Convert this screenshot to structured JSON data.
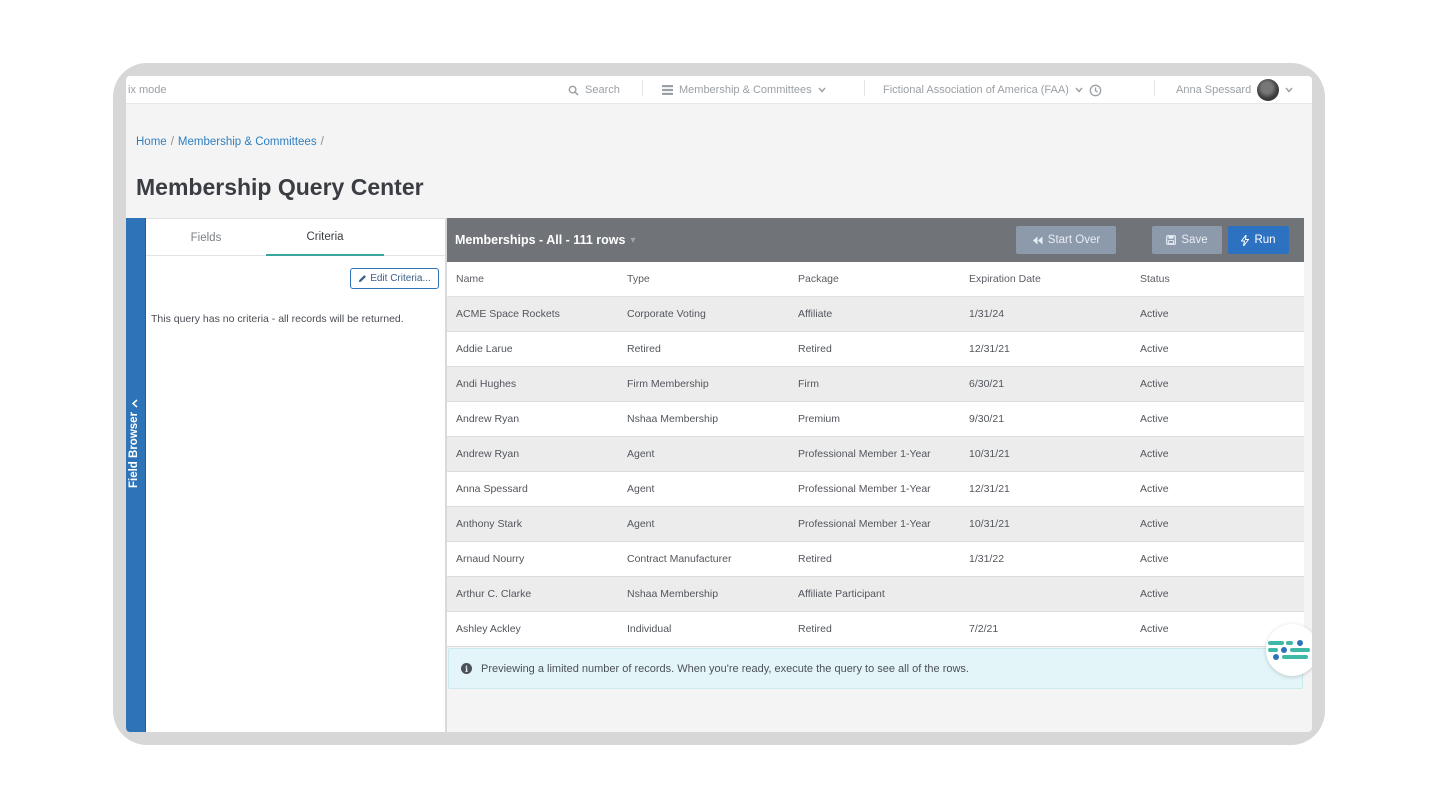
{
  "topbar": {
    "mode_label": "ix mode",
    "search_placeholder": "Search",
    "module_label": "Membership & Committees",
    "org_label": "Fictional Association of America (FAA)",
    "user_name": "Anna Spessard"
  },
  "breadcrumb": {
    "home": "Home",
    "section": "Membership & Committees"
  },
  "page_title": "Membership Query Center",
  "field_browser_label": "Field Browser",
  "left_panel": {
    "tabs": [
      {
        "label": "Fields",
        "active": false
      },
      {
        "label": "Criteria",
        "active": true
      }
    ],
    "edit_criteria_label": "Edit Criteria...",
    "no_criteria_text": "This query has no criteria - all records will be returned."
  },
  "results": {
    "title": "Memberships - All - 111 rows",
    "start_over_label": "Start Over",
    "save_label": "Save",
    "run_label": "Run",
    "columns": [
      "Name",
      "Type",
      "Package",
      "Expiration Date",
      "Status"
    ],
    "rows": [
      [
        "ACME Space Rockets",
        "Corporate Voting",
        "Affiliate",
        "1/31/24",
        "Active"
      ],
      [
        "Addie Larue",
        "Retired",
        "Retired",
        "12/31/21",
        "Active"
      ],
      [
        "Andi Hughes",
        "Firm Membership",
        "Firm",
        "6/30/21",
        "Active"
      ],
      [
        "Andrew Ryan",
        "Nshaa Membership",
        "Premium",
        "9/30/21",
        "Active"
      ],
      [
        "Andrew Ryan",
        "Agent",
        "Professional Member 1-Year",
        "10/31/21",
        "Active"
      ],
      [
        "Anna Spessard",
        "Agent",
        "Professional Member 1-Year",
        "12/31/21",
        "Active"
      ],
      [
        "Anthony Stark",
        "Agent",
        "Professional Member 1-Year",
        "10/31/21",
        "Active"
      ],
      [
        "Arnaud Nourry",
        "Contract Manufacturer",
        "Retired",
        "1/31/22",
        "Active"
      ],
      [
        "Arthur C. Clarke",
        "Nshaa Membership",
        "Affiliate Participant",
        "",
        "Active"
      ],
      [
        "Ashley Ackley",
        "Individual",
        "Retired",
        "7/2/21",
        "Active"
      ]
    ],
    "preview_note": "Previewing a limited number of records. When you're ready, execute the query to see all of the rows."
  },
  "colors": {
    "accent": "#2d73b8",
    "run_button": "#2c72c1",
    "header_bar": "#707378",
    "tab_underline": "#3aa6a0",
    "note_bg": "#e3f5f8"
  }
}
